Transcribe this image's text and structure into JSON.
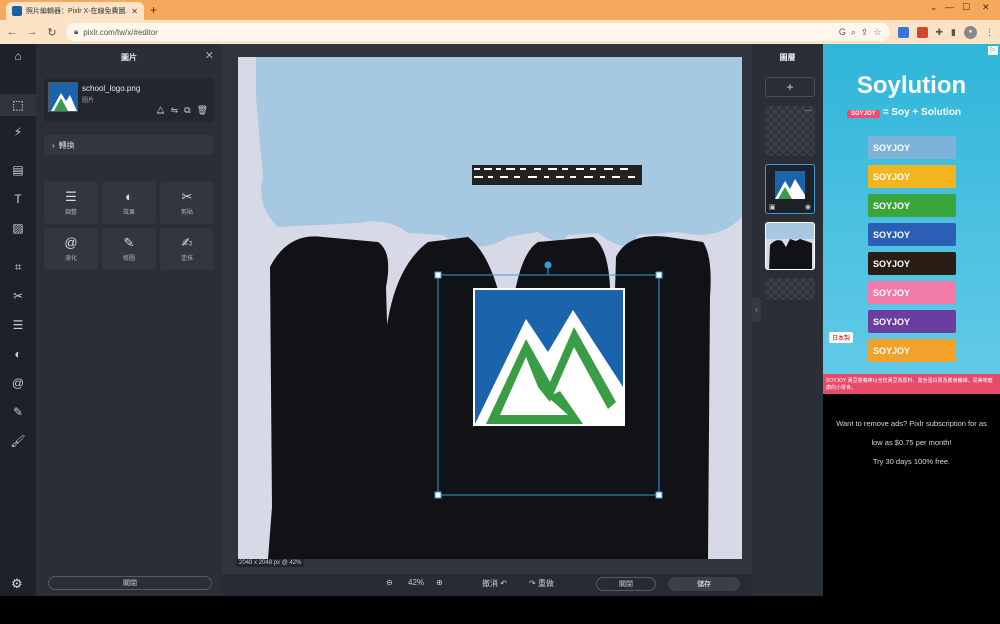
{
  "browser": {
    "tab_title": "照片編輯器：Pixlr X-在線免費圖...",
    "url": "pixlr.com/tw/x/#editor"
  },
  "left_panel": {
    "title": "圖片",
    "layer_name": "school_logo.png",
    "layer_subtitle": "圖片",
    "transform_label": "轉換",
    "tools": [
      {
        "label": "調整",
        "icon": "sliders-icon"
      },
      {
        "label": "效果",
        "icon": "contrast-icon"
      },
      {
        "label": "剪貼",
        "icon": "scissors-icon"
      },
      {
        "label": "液化",
        "icon": "spiral-icon"
      },
      {
        "label": "修圖",
        "icon": "bandage-icon"
      },
      {
        "label": "塗抹",
        "icon": "smudge-icon"
      }
    ],
    "close_label": "關閉"
  },
  "canvas": {
    "info": "2048 x 2048 px @ 42%"
  },
  "bottom_bar": {
    "zoom": "42%",
    "undo": "撤消",
    "redo": "重做",
    "close": "關閉",
    "save": "儲存"
  },
  "right_panel": {
    "title": "圖層"
  },
  "ad": {
    "title": "Soylution",
    "tagline": "= Soy + Solution",
    "pill": "SOYJOY",
    "bar_label": "SOYJOY",
    "bars": [
      {
        "color": "#7fb2d8"
      },
      {
        "color": "#f2b51f"
      },
      {
        "color": "#3aa53c"
      },
      {
        "color": "#2b5fb5"
      },
      {
        "color": "#2a1d14"
      },
      {
        "color": "#f07aa8"
      },
      {
        "color": "#6a3ea0"
      },
      {
        "color": "#f2a12a"
      }
    ],
    "brand": "日本製",
    "footer": "SOYJOY 黃豆營養棒以全粒黃豆為原料，富含蛋白質及膳食纖維，是美味健康的小零食。",
    "promo_line1": "Want to remove ads? Pixlr subscription for as",
    "promo_line2": "low as $0.75 per month!",
    "promo_line3": "Try 30 days 100% free."
  }
}
